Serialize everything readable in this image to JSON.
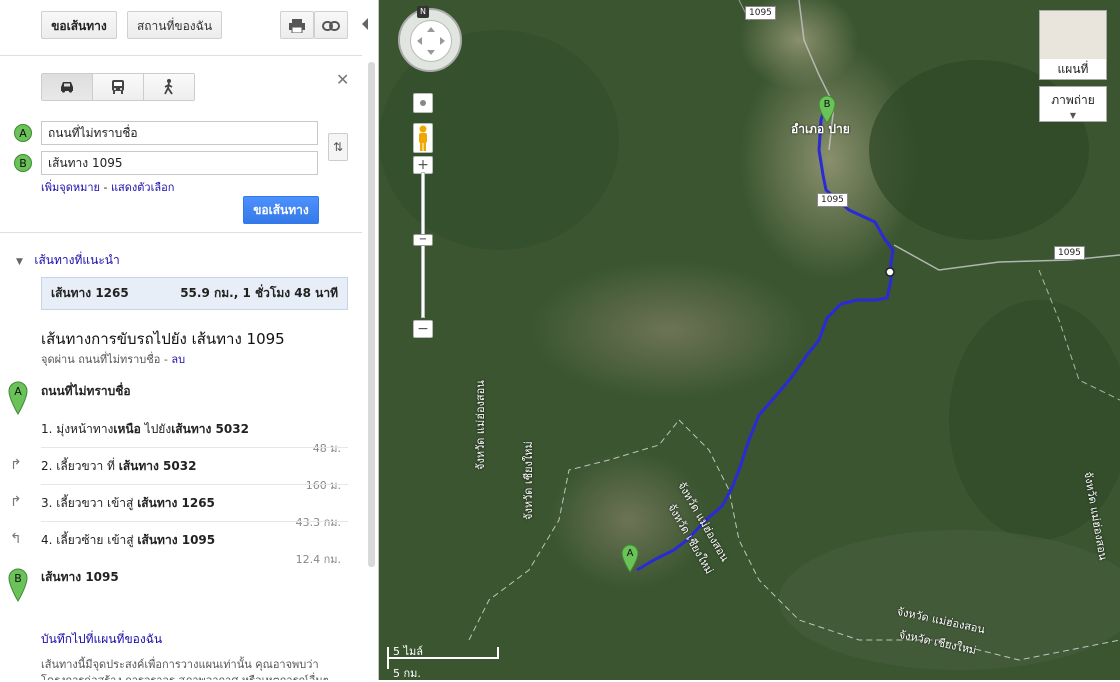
{
  "toolbar": {
    "get_directions_label": "ขอเส้นทาง",
    "my_places_label": "สถานที่ของฉัน",
    "print_icon": "print-icon",
    "link_icon": "link-icon"
  },
  "directions_form": {
    "modes": [
      {
        "name": "car-icon"
      },
      {
        "name": "bus-icon"
      },
      {
        "name": "walk-icon"
      }
    ],
    "start_marker": "A",
    "end_marker": "B",
    "start_value": "ถนนที่ไม่ทราบชื่อ",
    "end_value": "เส้นทาง 1095",
    "add_destination_link": "เพิ่มจุดหมาย",
    "separator": " - ",
    "show_options_link": "แสดงตัวเลือก",
    "submit_label": "ขอเส้นทาง"
  },
  "suggested": {
    "heading": "เส้นทางที่แนะนำ",
    "route_name": "เส้นทาง 1265",
    "route_summary": "55.9 กม., 1 ชั่วโมง 48 นาที"
  },
  "directions": {
    "title": "เส้นทางการขับรถไปยัง เส้นทาง 1095",
    "via_text": "จุดผ่าน ถนนที่ไม่ทราบชื่อ - ",
    "remove_link": "ลบ",
    "start_name": "ถนนที่ไม่ทราบชื่อ",
    "steps": [
      {
        "num": "1.",
        "text_pre": "มุ่งหน้าทาง",
        "bold1": "เหนือ",
        "text_mid": " ไปยัง",
        "bold2": "เส้นทาง 5032",
        "dist": "48 ม."
      },
      {
        "num": "2.",
        "text_pre": "เลี้ยวขวา ที่ ",
        "bold1": "",
        "text_mid": "",
        "bold2": "เส้นทาง 5032",
        "dist": "160 ม."
      },
      {
        "num": "3.",
        "text_pre": "เลี้ยวขวา เข้าสู่ ",
        "bold1": "",
        "text_mid": "",
        "bold2": "เส้นทาง 1265",
        "dist": "43.3 กม."
      },
      {
        "num": "4.",
        "text_pre": "เลี้ยวซ้าย เข้าสู่ ",
        "bold1": "",
        "text_mid": "",
        "bold2": "เส้นทาง 1095",
        "dist": "12.4 กม."
      }
    ],
    "end_name": "เส้นทาง 1095",
    "save_link": "บันทึกไปที่แผนที่ของฉัน",
    "disclaimer": "เส้นทางนี้มีจุดประสงค์เพื่อการวางแผนเท่านั้น คุณอาจพบว่าโครงการก่อสร้าง การจราจร สภาพอากาศ หรือเหตุการณ์อื่นๆ อาจ"
  },
  "map": {
    "map_type_map": "แผนที่",
    "map_type_satellite": "ภาพถ่าย",
    "place_name": "อำเภอ ปาย",
    "road_labels": [
      "1095",
      "1095",
      "1095"
    ],
    "provinces": [
      "จังหวัด แม่ฮ่องสอน",
      "จังหวัด เชียงใหม่",
      "จังหวัด แม่ฮ่องสอน",
      "จังหวัด เชียงใหม่",
      "จังหวัด แม่ฮ่องสอน",
      "จังหวัด เชียงใหม่",
      "จังหวัด แม่ฮ่องสอน"
    ],
    "marker_a": "A",
    "marker_b": "B",
    "scale_miles": "5 ไมล์",
    "scale_km": "5 กม.",
    "compass_n": "N",
    "colors": {
      "route": "#2a2ad6",
      "marker": "#6ac259"
    }
  }
}
